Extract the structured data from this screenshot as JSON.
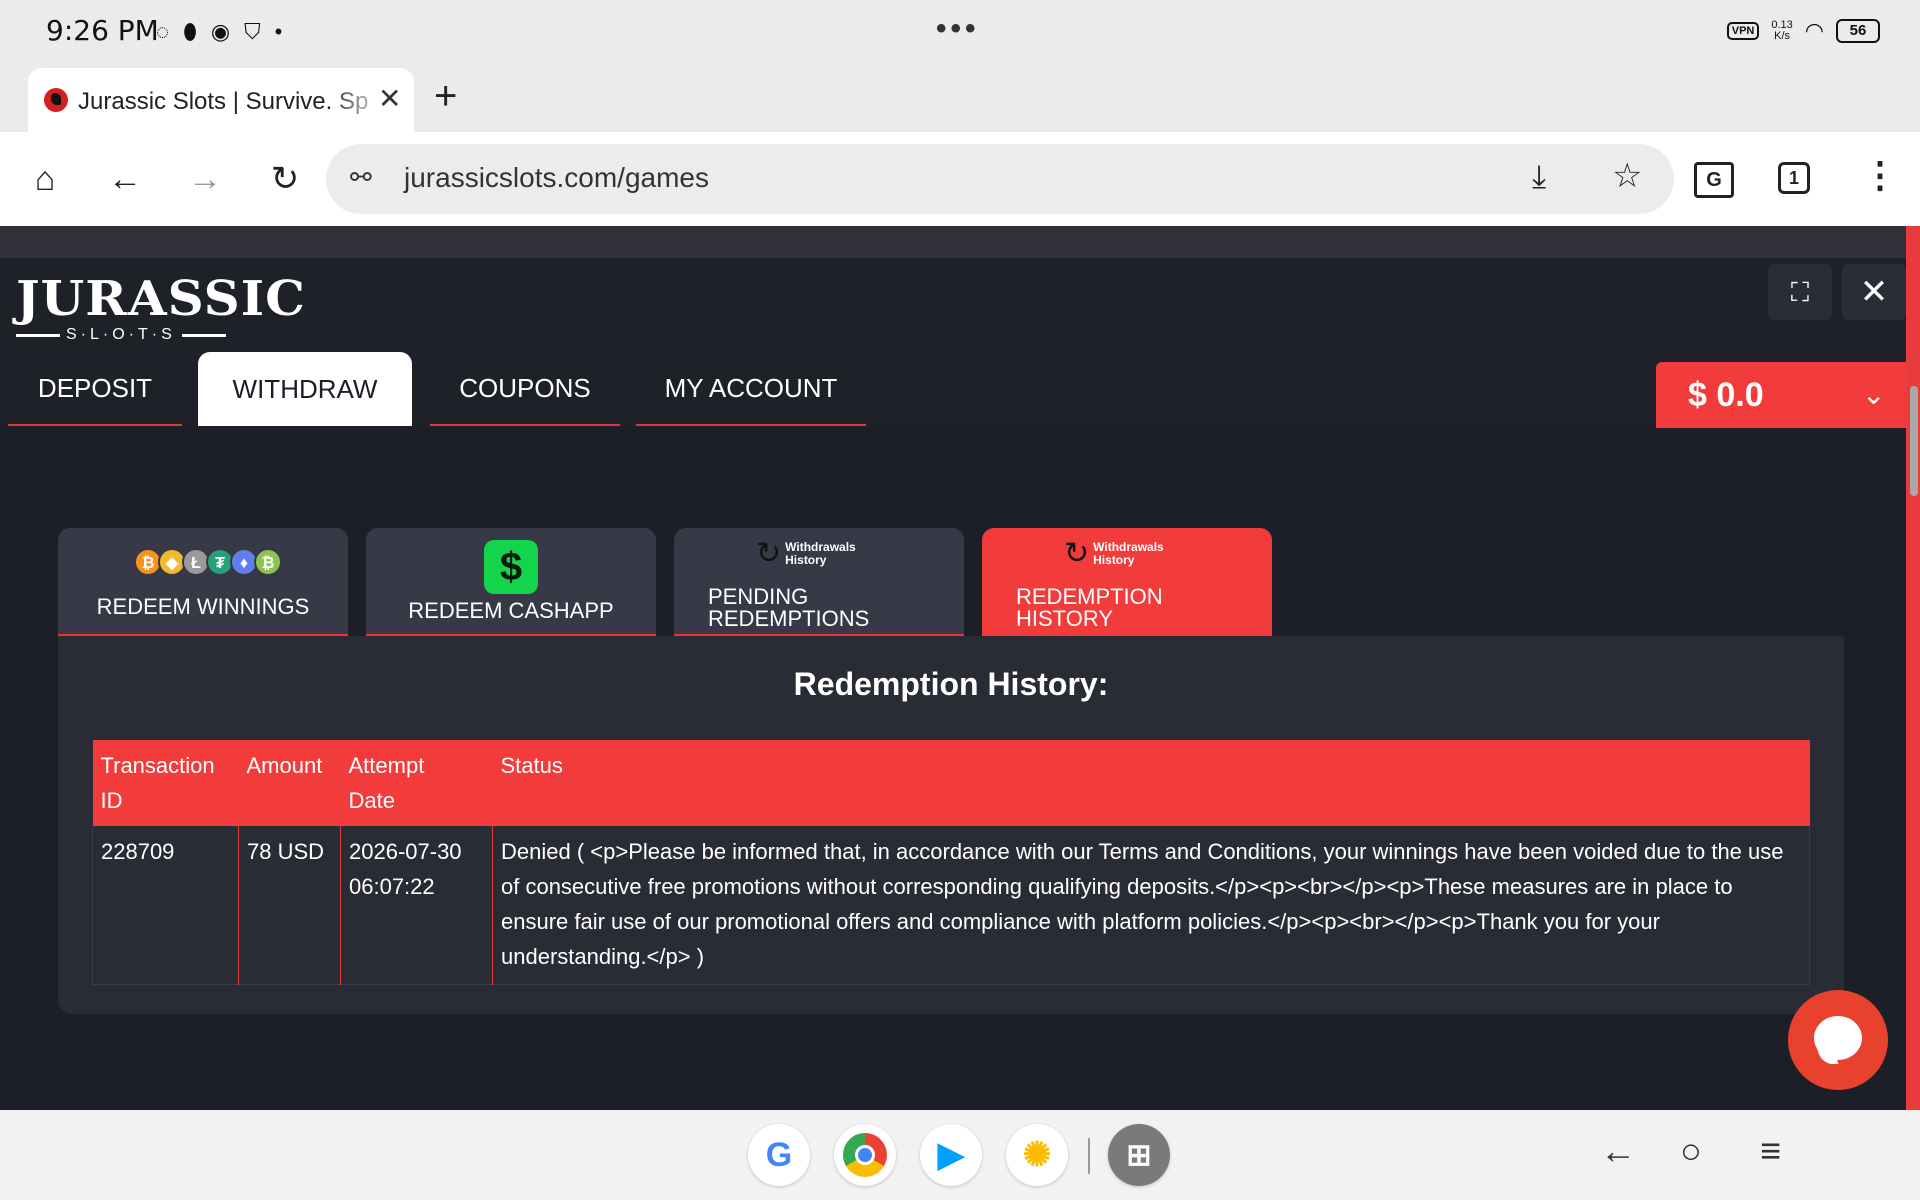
{
  "status_bar": {
    "time": "9:26 PM",
    "more_dots": "•••",
    "vpn": "VPN",
    "speed_value": "0.13",
    "speed_unit": "K/s",
    "battery": "56"
  },
  "browser": {
    "tab_title": "Jurassic Slots | Survive. Spin",
    "url": "jurassicslots.com/games",
    "tab_count": "1"
  },
  "site": {
    "logo_main": "JURASSIC",
    "logo_sub": "S·L·O·T·S",
    "nav_tabs": [
      {
        "label": "DEPOSIT"
      },
      {
        "label": "WITHDRAW"
      },
      {
        "label": "COUPONS"
      },
      {
        "label": "MY ACCOUNT"
      }
    ],
    "balance": "$ 0.0",
    "colors": {
      "accent": "#f23b3b",
      "background": "#1b1d27",
      "panel": "#2a2c35",
      "card": "#373947"
    }
  },
  "withdraw_methods": [
    {
      "label": "REDEEM WINNINGS",
      "icon": "crypto-coins-icon"
    },
    {
      "label": "REDEEM CASHAPP",
      "icon": "cashapp-icon"
    },
    {
      "label_line1": "PENDING",
      "label_line2": "REDEMPTIONS",
      "icon_text_1": "Withdrawals",
      "icon_text_2": "History"
    },
    {
      "label_line1": "REDEMPTION",
      "label_line2": "HISTORY",
      "icon_text_1": "Withdrawals",
      "icon_text_2": "History"
    }
  ],
  "history": {
    "title": "Redemption History:",
    "columns": [
      {
        "line1": "Transaction",
        "line2": "ID"
      },
      {
        "line1": "Amount",
        "line2": ""
      },
      {
        "line1": "Attempt",
        "line2": "Date"
      },
      {
        "line1": "Status",
        "line2": ""
      }
    ],
    "rows": [
      {
        "transaction_id": "228709",
        "amount": "78 USD",
        "date": "2026-07-30",
        "time": "06:07:22",
        "status": "Denied ( <p>Please be informed that, in accordance with our Terms and Conditions, your winnings have been voided due to the use of consecutive free promotions without corresponding qualifying deposits.</p><p><br></p><p>These measures are in place to ensure fair use of our promotional offers and compliance with platform policies.</p><p><br></p><p>Thank you for your understanding.</p> )"
      }
    ]
  }
}
